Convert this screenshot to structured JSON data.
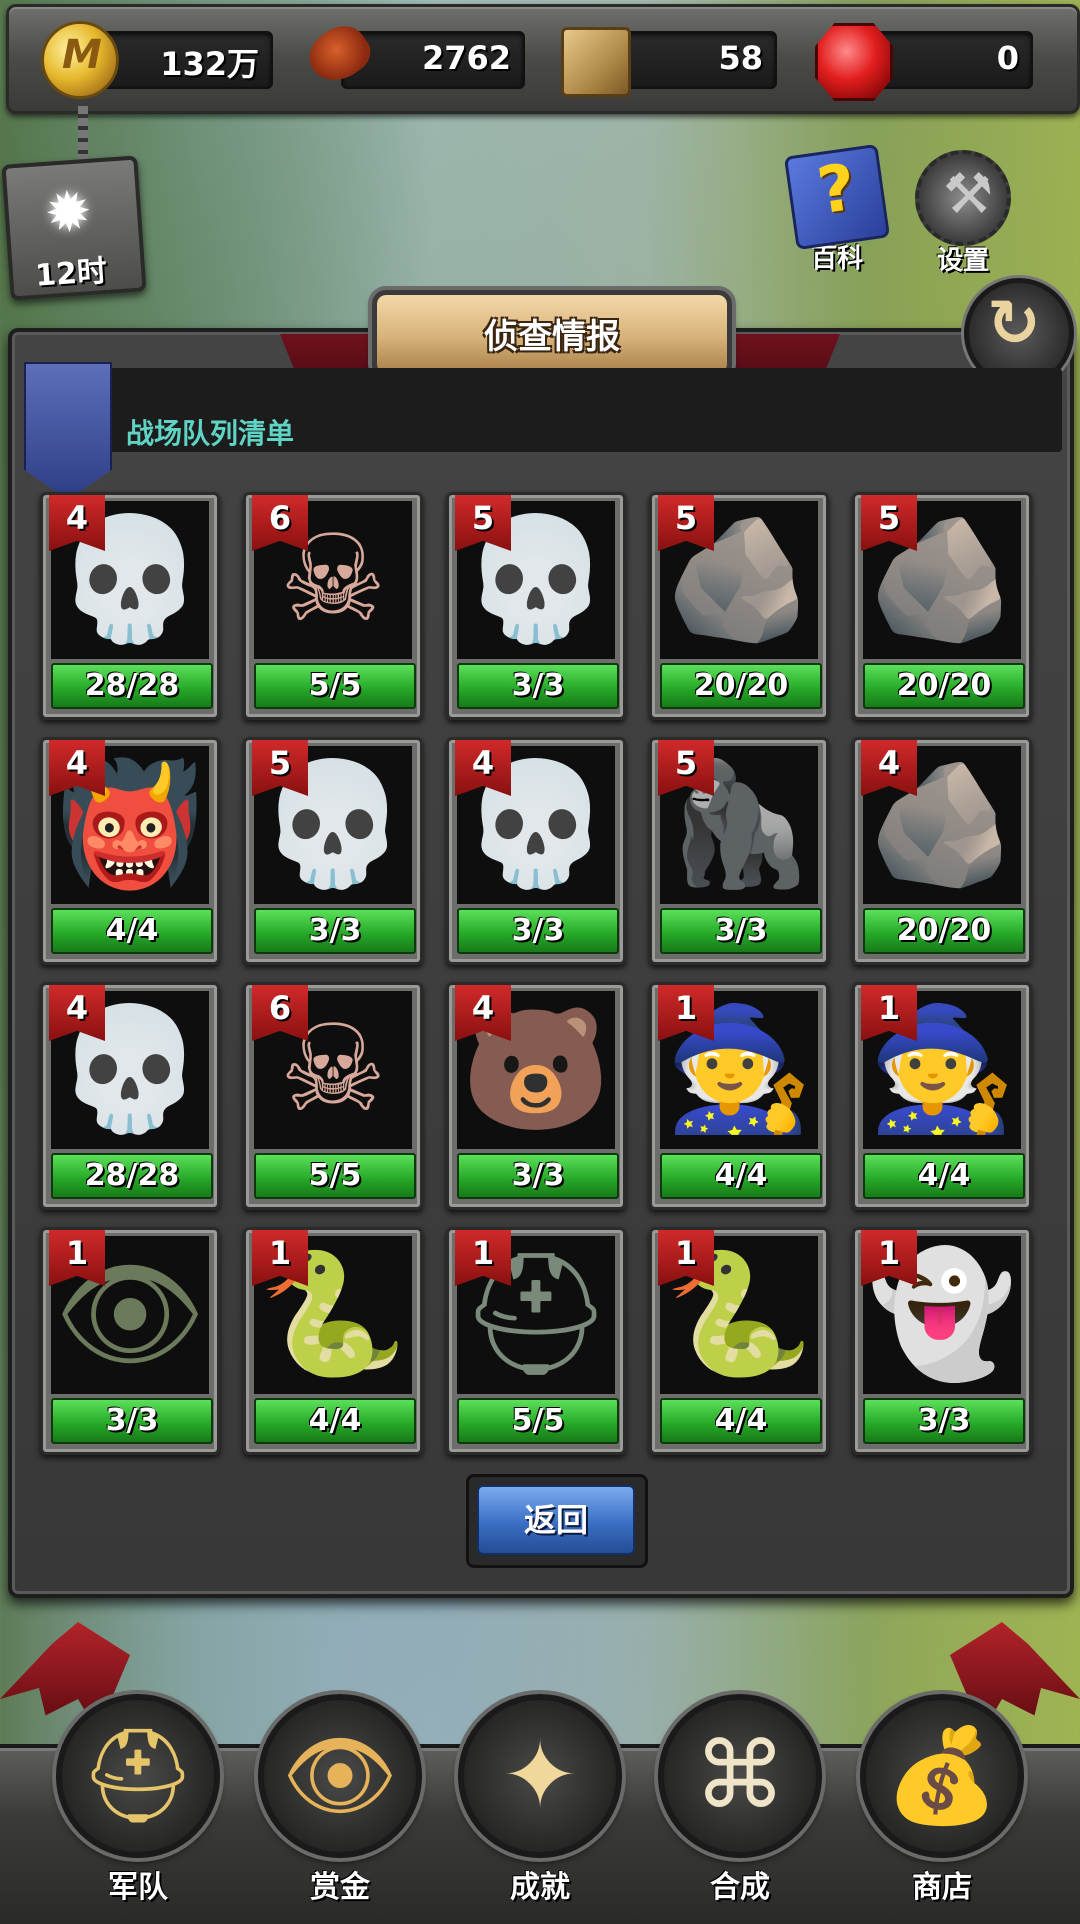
{
  "resources": {
    "gold": {
      "icon": "gold-coin-icon",
      "value": "132万"
    },
    "food": {
      "icon": "meat-drumstick-icon",
      "value": "2762"
    },
    "wood": {
      "icon": "wood-crate-icon",
      "value": "58"
    },
    "gems": {
      "icon": "red-gem-icon",
      "value": "0"
    }
  },
  "time": {
    "icon": "sun-icon",
    "label": "12时"
  },
  "top_right": {
    "encyclopedia": {
      "icon": "question-book-icon",
      "label": "百科"
    },
    "settings": {
      "icon": "hammer-gear-icon",
      "label": "设置"
    }
  },
  "panel": {
    "title": "侦查情报",
    "refresh_icon": "refresh-icon",
    "list_title": "战场队列清单",
    "back_label": "返回"
  },
  "units": [
    {
      "level": "4",
      "hp": "28/28",
      "icon": "skeleton-icon"
    },
    {
      "level": "6",
      "hp": "5/5",
      "icon": "spiked-skull-warrior-icon"
    },
    {
      "level": "5",
      "hp": "3/3",
      "icon": "hooded-skull-icon"
    },
    {
      "level": "5",
      "hp": "20/20",
      "icon": "rock-golem-icon"
    },
    {
      "level": "5",
      "hp": "20/20",
      "icon": "rock-golem-icon"
    },
    {
      "level": "4",
      "hp": "4/4",
      "icon": "red-demon-icon"
    },
    {
      "level": "5",
      "hp": "3/3",
      "icon": "hooded-skull-icon"
    },
    {
      "level": "4",
      "hp": "3/3",
      "icon": "hooded-skull-icon"
    },
    {
      "level": "5",
      "hp": "3/3",
      "icon": "blue-yeti-icon"
    },
    {
      "level": "4",
      "hp": "20/20",
      "icon": "rock-golem-icon"
    },
    {
      "level": "4",
      "hp": "28/28",
      "icon": "skeleton-icon"
    },
    {
      "level": "6",
      "hp": "5/5",
      "icon": "spiked-skull-warrior-icon"
    },
    {
      "level": "4",
      "hp": "3/3",
      "icon": "werebear-icon"
    },
    {
      "level": "1",
      "hp": "4/4",
      "icon": "purple-wizard-icon"
    },
    {
      "level": "1",
      "hp": "4/4",
      "icon": "purple-wizard-icon"
    },
    {
      "level": "1",
      "hp": "3/3",
      "icon": "eye-monster-icon"
    },
    {
      "level": "1",
      "hp": "4/4",
      "icon": "serpent-icon"
    },
    {
      "level": "1",
      "hp": "5/5",
      "icon": "horned-knight-icon"
    },
    {
      "level": "1",
      "hp": "4/4",
      "icon": "serpent-icon"
    },
    {
      "level": "1",
      "hp": "3/3",
      "icon": "grey-wraith-icon"
    }
  ],
  "nav": [
    {
      "label": "军队",
      "icon": "helmet-icon"
    },
    {
      "label": "赏金",
      "icon": "dragon-eye-icon"
    },
    {
      "label": "成就",
      "icon": "compass-star-icon"
    },
    {
      "label": "合成",
      "icon": "celtic-knot-icon"
    },
    {
      "label": "商店",
      "icon": "money-bag-icon"
    }
  ]
}
